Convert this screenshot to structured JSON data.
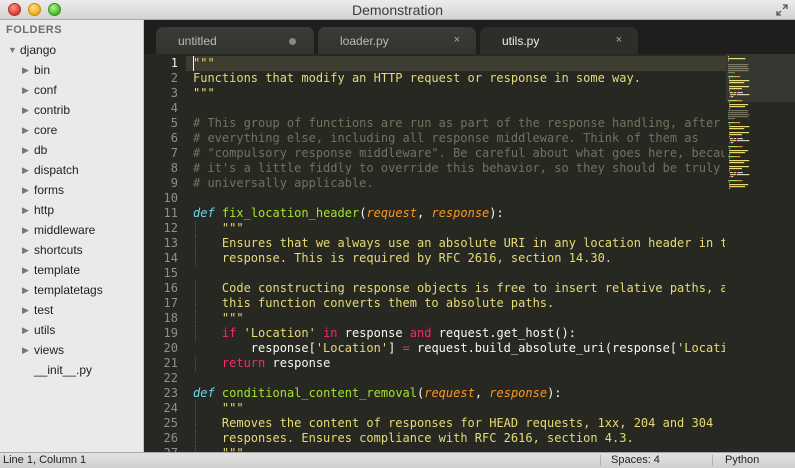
{
  "window": {
    "title": "Demonstration"
  },
  "sidebar": {
    "header": "FOLDERS",
    "root": "django",
    "folders": [
      "bin",
      "conf",
      "contrib",
      "core",
      "db",
      "dispatch",
      "forms",
      "http",
      "middleware",
      "shortcuts",
      "template",
      "templatetags",
      "test",
      "utils",
      "views"
    ],
    "files": [
      "__init__.py"
    ]
  },
  "tabs": [
    {
      "label": "untitled",
      "state": "modified"
    },
    {
      "label": "loader.py",
      "state": "close"
    },
    {
      "label": "utils.py",
      "state": "close",
      "active": true
    }
  ],
  "tab_close_glyph": "×",
  "editor": {
    "line_numbers": [
      "1",
      "2",
      "3",
      "4",
      "5",
      "6",
      "7",
      "8",
      "9",
      "10",
      "11",
      "12",
      "13",
      "14",
      "15",
      "16",
      "17",
      "18",
      "19",
      "20",
      "21",
      "22",
      "23",
      "24",
      "25",
      "26",
      "27"
    ],
    "lines": [
      [
        [
          "s",
          "\"\"\""
        ]
      ],
      [
        [
          "s",
          "Functions that modify an HTTP request or response in some way."
        ]
      ],
      [
        [
          "s",
          "\"\"\""
        ]
      ],
      [],
      [
        [
          "c",
          "# This group of functions are run as part of the response handling, after"
        ]
      ],
      [
        [
          "c",
          "# everything else, including all response middleware. Think of them as"
        ]
      ],
      [
        [
          "c",
          "# \"compulsory response middleware\". Be careful about what goes here, because"
        ]
      ],
      [
        [
          "c",
          "# it's a little fiddly to override this behavior, so they should be truly"
        ]
      ],
      [
        [
          "c",
          "# universally applicable."
        ]
      ],
      [],
      [
        [
          "d",
          "def"
        ],
        [
          "w",
          " "
        ],
        [
          "f",
          "fix_location_header"
        ],
        [
          "w",
          "("
        ],
        [
          "p",
          "request"
        ],
        [
          "w",
          ", "
        ],
        [
          "p",
          "response"
        ],
        [
          "w",
          "):"
        ]
      ],
      [
        [
          "w",
          "    "
        ],
        [
          "s",
          "\"\"\""
        ]
      ],
      [
        [
          "w",
          "    "
        ],
        [
          "s",
          "Ensures that we always use an absolute URI in any location header in the"
        ]
      ],
      [
        [
          "w",
          "    "
        ],
        [
          "s",
          "response. This is required by RFC 2616, section 14.30."
        ]
      ],
      [],
      [
        [
          "w",
          "    "
        ],
        [
          "s",
          "Code constructing response objects is free to insert relative paths, as"
        ]
      ],
      [
        [
          "w",
          "    "
        ],
        [
          "s",
          "this function converts them to absolute paths."
        ]
      ],
      [
        [
          "w",
          "    "
        ],
        [
          "s",
          "\"\"\""
        ]
      ],
      [
        [
          "w",
          "    "
        ],
        [
          "k",
          "if"
        ],
        [
          "w",
          " "
        ],
        [
          "s",
          "'Location'"
        ],
        [
          "w",
          " "
        ],
        [
          "k",
          "in"
        ],
        [
          "w",
          " response "
        ],
        [
          "k",
          "and"
        ],
        [
          "w",
          " request.get_host():"
        ]
      ],
      [
        [
          "w",
          "        response["
        ],
        [
          "s",
          "'Location'"
        ],
        [
          "w",
          "] "
        ],
        [
          "k",
          "="
        ],
        [
          "w",
          " request.build_absolute_uri(response["
        ],
        [
          "s",
          "'Location"
        ]
      ],
      [
        [
          "w",
          "    "
        ],
        [
          "k",
          "return"
        ],
        [
          "w",
          " response"
        ]
      ],
      [],
      [
        [
          "d",
          "def"
        ],
        [
          "w",
          " "
        ],
        [
          "f",
          "conditional_content_removal"
        ],
        [
          "w",
          "("
        ],
        [
          "p",
          "request"
        ],
        [
          "w",
          ", "
        ],
        [
          "p",
          "response"
        ],
        [
          "w",
          "):"
        ]
      ],
      [
        [
          "w",
          "    "
        ],
        [
          "s",
          "\"\"\""
        ]
      ],
      [
        [
          "w",
          "    "
        ],
        [
          "s",
          "Removes the content of responses for HEAD requests, 1xx, 204 and 304"
        ]
      ],
      [
        [
          "w",
          "    "
        ],
        [
          "s",
          "responses. Ensures compliance with RFC 2616, section 4.3."
        ]
      ],
      [
        [
          "w",
          "    "
        ],
        [
          "s",
          "\"\"\""
        ]
      ]
    ]
  },
  "statusbar": {
    "position": "Line 1, Column 1",
    "spaces": "Spaces: 4",
    "syntax": "Python"
  }
}
